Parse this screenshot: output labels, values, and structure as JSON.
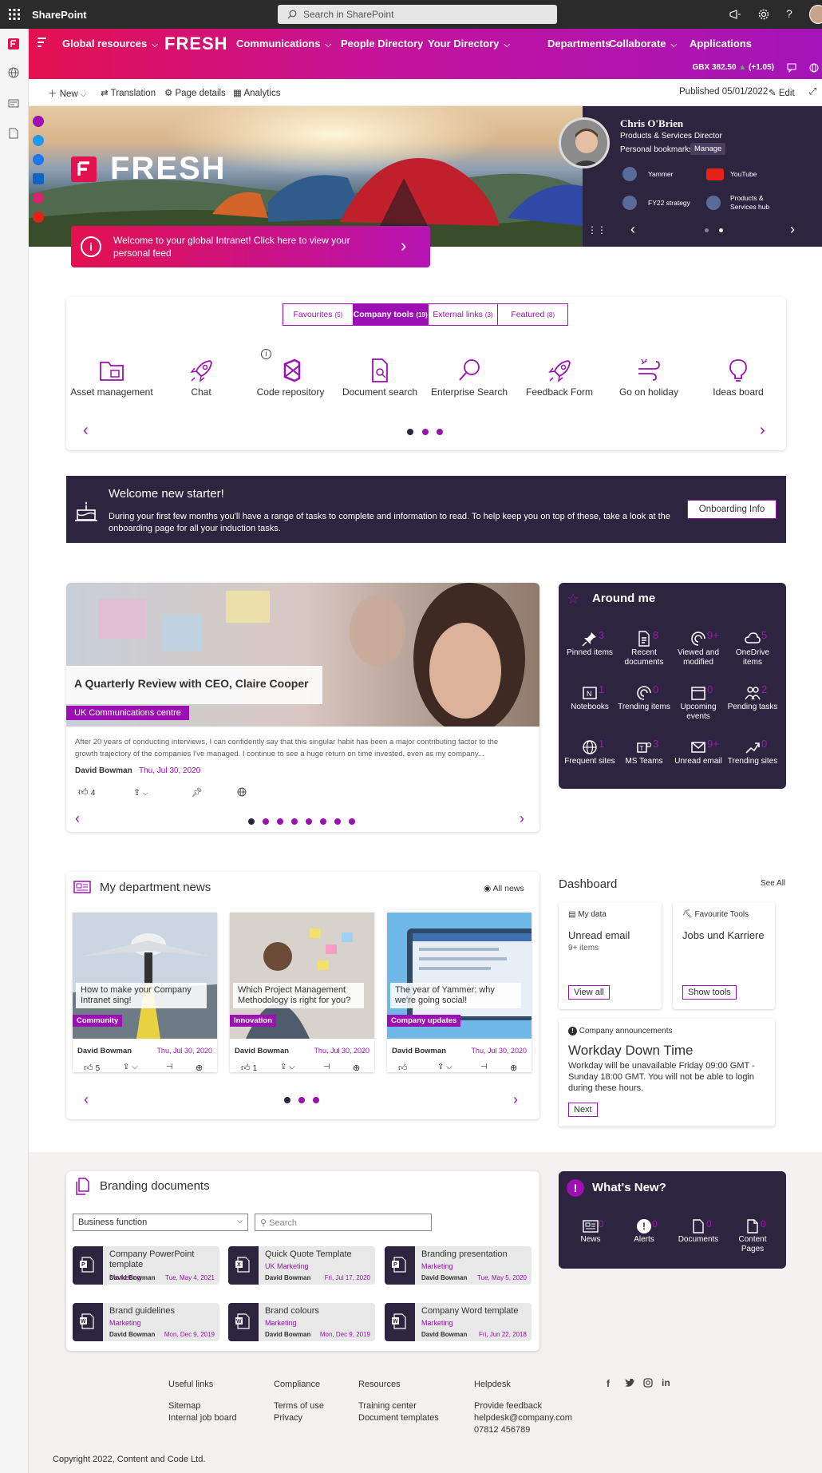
{
  "suite": {
    "app_name": "SharePoint",
    "search_placeholder": "Search in SharePoint"
  },
  "nav": {
    "items": [
      "Global resources",
      "FRESH",
      "Communications",
      "People Directory",
      "Your Directory",
      "Departments",
      "Collaborate",
      "Applications"
    ],
    "stock": "GBX 382.50",
    "stock_change": "(+1.05)"
  },
  "cmdbar": {
    "new": "New",
    "translation": "Translation",
    "page_details": "Page details",
    "analytics": "Analytics",
    "published": "Published 05/01/2022",
    "edit": "Edit"
  },
  "hero": {
    "logo_text": "FRESH"
  },
  "welcome": {
    "text": "Welcome to your global Intranet! Click here to view your personal feed"
  },
  "profile": {
    "name": "Chris O'Brien",
    "role": "Products & Services Director",
    "bookmarks": "Personal bookmarks",
    "manage": "Manage",
    "links": [
      "Yammer",
      "YouTube",
      "FY22 strategy",
      "Products & Services hub"
    ]
  },
  "quicklinks": {
    "tabs": [
      {
        "label": "Favourites",
        "count": "(5)"
      },
      {
        "label": "Company tools",
        "count": "(19)"
      },
      {
        "label": "External links",
        "count": "(3)"
      },
      {
        "label": "Featured",
        "count": "(8)"
      }
    ],
    "items": [
      "Asset management",
      "Chat",
      "Code repository",
      "Document search",
      "Enterprise Search",
      "Feedback Form",
      "Go on holiday",
      "Ideas board"
    ]
  },
  "starter": {
    "title": "Welcome new starter!",
    "body": "During your first few months you'll have a range of tasks to complete and information to read. To help keep you on top of these, take a look at the onboarding page for all your induction tasks.",
    "button": "Onboarding Info"
  },
  "featured_news": {
    "title": "A Quarterly Review with CEO, Claire Cooper",
    "tag": "UK Communications centre",
    "excerpt": "After 20 years of conducting interviews, I can confidently say that this singular habit has been a major contributing factor to the growth trajectory of the companies I've managed. I continue to see a huge return on time invested, even as my company...",
    "author": "David Bowman",
    "date": "Thu, Jul 30, 2020",
    "likes": "4"
  },
  "around_me": {
    "title": "Around me",
    "items": [
      {
        "label": "Pinned items",
        "count": "3"
      },
      {
        "label": "Recent documents",
        "count": "8"
      },
      {
        "label": "Viewed and modified",
        "count": "9+"
      },
      {
        "label": "OneDrive items",
        "count": "5"
      },
      {
        "label": "Notebooks",
        "count": "1"
      },
      {
        "label": "Trending items",
        "count": "0"
      },
      {
        "label": "Upcoming events",
        "count": "0"
      },
      {
        "label": "Pending tasks",
        "count": "2"
      },
      {
        "label": "Frequent sites",
        "count": "1"
      },
      {
        "label": "MS Teams",
        "count": "3"
      },
      {
        "label": "Unread email",
        "count": "9+"
      },
      {
        "label": "Trending sites",
        "count": "0"
      }
    ]
  },
  "dept_news": {
    "title": "My department news",
    "all_news": "All news",
    "cards": [
      {
        "title": "How to make your Company Intranet sing!",
        "tag": "Community",
        "author": "David Bowman",
        "date": "Thu, Jul 30, 2020",
        "likes": "5"
      },
      {
        "title": "Which Project Management Methodology is right for you?",
        "tag": "Innovation",
        "author": "David Bowman",
        "date": "Thu, Jul 30, 2020",
        "likes": "1"
      },
      {
        "title": "The year of Yammer: why we're going social!",
        "tag": "Company updates",
        "author": "David Bowman",
        "date": "Thu, Jul 30, 2020",
        "likes": ""
      }
    ]
  },
  "dashboard": {
    "title": "Dashboard",
    "see_all": "See All",
    "mydata": {
      "header": "My data",
      "title": "Unread email",
      "sub": "9+ items",
      "button": "View all"
    },
    "tools": {
      "header": "Favourite Tools",
      "title": "Jobs und Karriere",
      "button": "Show tools"
    },
    "announce": {
      "header": "Company announcements",
      "title": "Workday Down Time",
      "body": "Workday will be unavailable Friday 09:00 GMT - Sunday 18:00 GMT. You will not be able to login during these hours.",
      "button": "Next"
    }
  },
  "branding": {
    "title": "Branding documents",
    "filter": "Business function",
    "search_placeholder": "Search",
    "docs": [
      {
        "title": "Company PowerPoint template",
        "meta": "Marketing",
        "author": "David Bowman",
        "date": "Tue, May 4, 2021"
      },
      {
        "title": "Quick Quote Template",
        "meta": "UK Marketing",
        "author": "David Bowman",
        "date": "Fri, Jul 17, 2020"
      },
      {
        "title": "Branding presentation",
        "meta": "Marketing",
        "author": "David Bowman",
        "date": "Tue, May 5, 2020"
      },
      {
        "title": "Brand guidelines",
        "meta": "Marketing",
        "author": "David Bowman",
        "date": "Mon, Dec 9, 2019"
      },
      {
        "title": "Brand colours",
        "meta": "Marketing",
        "author": "David Bowman",
        "date": "Mon, Dec 9, 2019"
      },
      {
        "title": "Company Word template",
        "meta": "Marketing",
        "author": "David Bowman",
        "date": "Fri, Jun 22, 2018"
      }
    ]
  },
  "whats_new": {
    "title": "What's New?",
    "items": [
      {
        "label": "News",
        "count": "0"
      },
      {
        "label": "Alerts",
        "count": "0"
      },
      {
        "label": "Documents",
        "count": "0"
      },
      {
        "label": "Content Pages",
        "count": "0"
      }
    ]
  },
  "footer": {
    "cols": [
      {
        "title": "Useful links",
        "links": [
          "Sitemap",
          "Internal job board"
        ]
      },
      {
        "title": "Compliance",
        "links": [
          "Terms of use",
          "Privacy"
        ]
      },
      {
        "title": "Resources",
        "links": [
          "Training center",
          "Document templates"
        ]
      },
      {
        "title": "Helpdesk",
        "links": [
          "Provide feedback",
          "helpdesk@company.com",
          "07812 456789"
        ]
      }
    ],
    "copyright": "Copyright 2022, Content and Code Ltd."
  },
  "colors": {
    "accent": "#9c0fb3",
    "dark": "#2d2440",
    "pink": "#e3114f"
  }
}
